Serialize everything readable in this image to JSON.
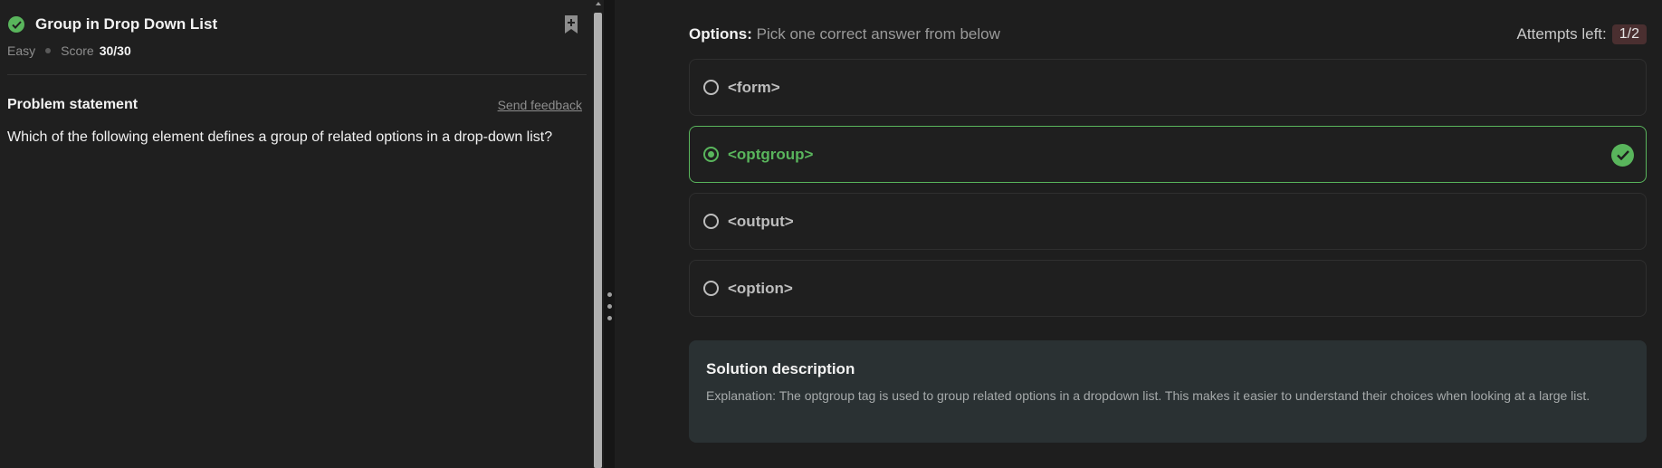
{
  "problem": {
    "title": "Group in Drop Down List",
    "difficulty": "Easy",
    "score_label": "Score",
    "score_value": "30/30",
    "statement_heading": "Problem statement",
    "feedback_link": "Send feedback",
    "statement_text": "Which of the following element defines a group of related options in a drop-down list?"
  },
  "options_panel": {
    "label": "Options:",
    "sublabel": "Pick one correct answer from below",
    "attempts_label": "Attempts left:",
    "attempts_value": "1/2",
    "options": [
      {
        "text": "<form>",
        "selected": false
      },
      {
        "text": "<optgroup>",
        "selected": true,
        "correct": true
      },
      {
        "text": "<output>",
        "selected": false
      },
      {
        "text": "<option>",
        "selected": false
      }
    ]
  },
  "solution": {
    "heading": "Solution description",
    "text": "Explanation: The optgroup tag is used to group related options in a dropdown list. This makes it easier to understand their choices when looking at a large list."
  },
  "colors": {
    "success": "#59b55c",
    "attempts_badge_bg": "#4a2f30",
    "solution_bg": "#2a3133"
  },
  "icons": {
    "status": "check-circle-icon",
    "bookmark": "bookmark-add-icon",
    "correct": "check-circle-icon",
    "splitter": "drag-handle-icon"
  }
}
